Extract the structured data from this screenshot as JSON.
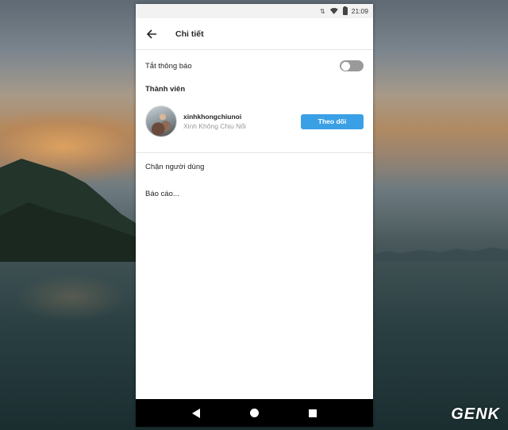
{
  "status_bar": {
    "data_indicator": "⇅",
    "time": "21:09"
  },
  "app_bar": {
    "back_icon": "arrow-left-icon",
    "title": "Chi tiết"
  },
  "settings": {
    "mute_label": "Tắt thông báo",
    "mute_enabled": false
  },
  "members": {
    "section_title": "Thành viên",
    "items": [
      {
        "username": "xinhkhongchiunoi",
        "full_name": "Xinh Không Chịu Nổi",
        "follow_label": "Theo dõi"
      }
    ]
  },
  "actions": {
    "block_label": "Chặn người dùng",
    "report_label": "Báo cáo..."
  },
  "watermark": {
    "text": "GENK"
  },
  "colors": {
    "accent": "#3aa0e6",
    "toggle_off": "#9a9a9a",
    "text_primary": "#262626",
    "text_secondary": "#999999",
    "nav_bar": "#000000"
  }
}
